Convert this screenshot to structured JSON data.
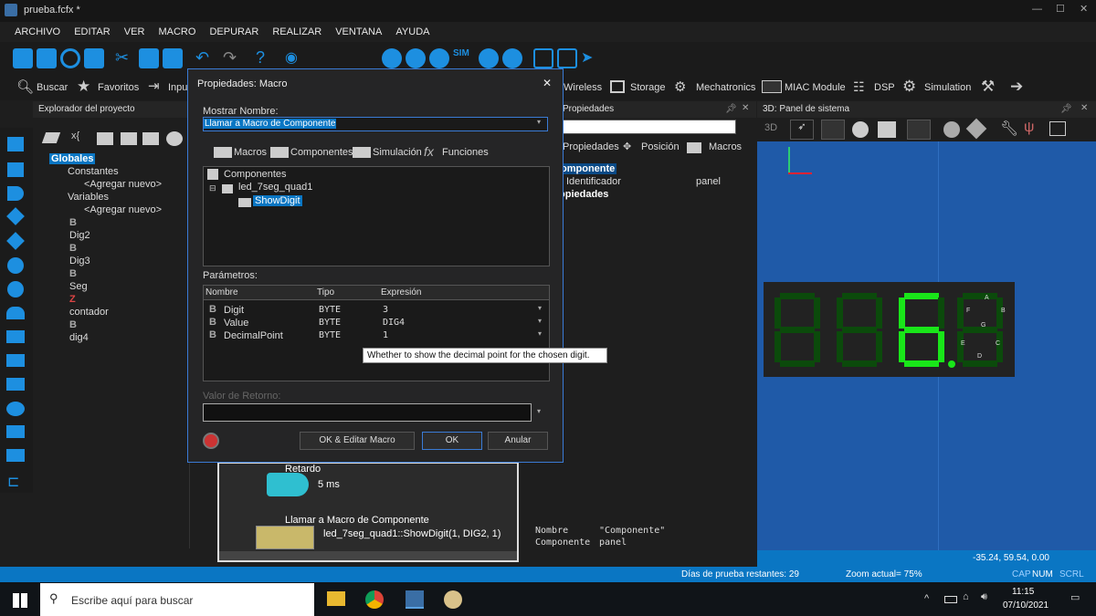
{
  "window": {
    "title": "prueba.fcfx *"
  },
  "menu": [
    "ARCHIVO",
    "EDITAR",
    "VER",
    "MACRO",
    "DEPURAR",
    "REALIZAR",
    "VENTANA",
    "AYUDA"
  ],
  "toolbar2": {
    "buscar": "Buscar",
    "favoritos": "Favoritos",
    "inputs": "Inpu",
    "wireless": "Wireless",
    "storage": "Storage",
    "mechatronics": "Mechatronics",
    "miac": "MIAC Module",
    "dsp": "DSP",
    "simulation": "Simulation"
  },
  "project_explorer": {
    "title": "Explorador del proyecto",
    "globals": "Globales",
    "constants": "Constantes",
    "add_new_1": "<Agregar nuevo>",
    "variables": "Variables",
    "add_new_2": "<Agregar nuevo>",
    "vars": [
      "Dig2",
      "Dig3",
      "Seg",
      "contador",
      "dig4"
    ]
  },
  "flow": {
    "delay_title": "Retardo",
    "delay_value": "5 ms",
    "call_title": "Llamar a Macro de Componente",
    "call_value": "led_7seg_quad1::ShowDigit(1, DIG2, 1)"
  },
  "properties_panel": {
    "title": "Propiedades",
    "tab_props": "Propiedades",
    "tab_position": "Posición",
    "tab_macros": "Macros",
    "section_component": "omponente",
    "identifier_label": "Identificador",
    "identifier_value": "panel",
    "section_props": "opiedades",
    "footer_name_label": "Nombre",
    "footer_name_value": "\"Componente\"",
    "footer_comp_label": "Componente",
    "footer_comp_value": "panel"
  },
  "panel3d": {
    "title": "3D: Panel de sistema",
    "view_label": "3D",
    "coords": "-35.24, 59.54, 0.00",
    "digit_labels": [
      "A",
      "F",
      "B",
      "G",
      "E",
      "C",
      "D"
    ]
  },
  "dialog": {
    "title": "Propiedades: Macro",
    "display_name_label": "Mostrar Nombre:",
    "display_name_value": "Llamar a Macro de Componente",
    "tabs": [
      "Macros",
      "Componentes",
      "Simulación",
      "Funciones"
    ],
    "tree_root": "Componentes",
    "tree_child": "led_7seg_quad1",
    "tree_leaf": "ShowDigit",
    "params_label": "Parámetros:",
    "col_name": "Nombre",
    "col_type": "Tipo",
    "col_expr": "Expresión",
    "params": [
      {
        "name": "Digit",
        "type": "BYTE",
        "expr": "3"
      },
      {
        "name": "Value",
        "type": "BYTE",
        "expr": "DIG4"
      },
      {
        "name": "DecimalPoint",
        "type": "BYTE",
        "expr": "1"
      }
    ],
    "return_label": "Valor de Retorno:",
    "ok_edit": "OK & Editar Macro",
    "ok": "OK",
    "cancel": "Anular"
  },
  "tooltip": "Whether to show the decimal point for the chosen digit.",
  "status": {
    "trial": "Días de prueba restantes: 29",
    "zoom": "Zoom actual= 75%",
    "cap": "CAP",
    "num": "NUM",
    "scrl": "SCRL"
  },
  "taskbar": {
    "search_placeholder": "Escribe aquí para buscar",
    "time": "11:15",
    "date": "07/10/2021"
  }
}
